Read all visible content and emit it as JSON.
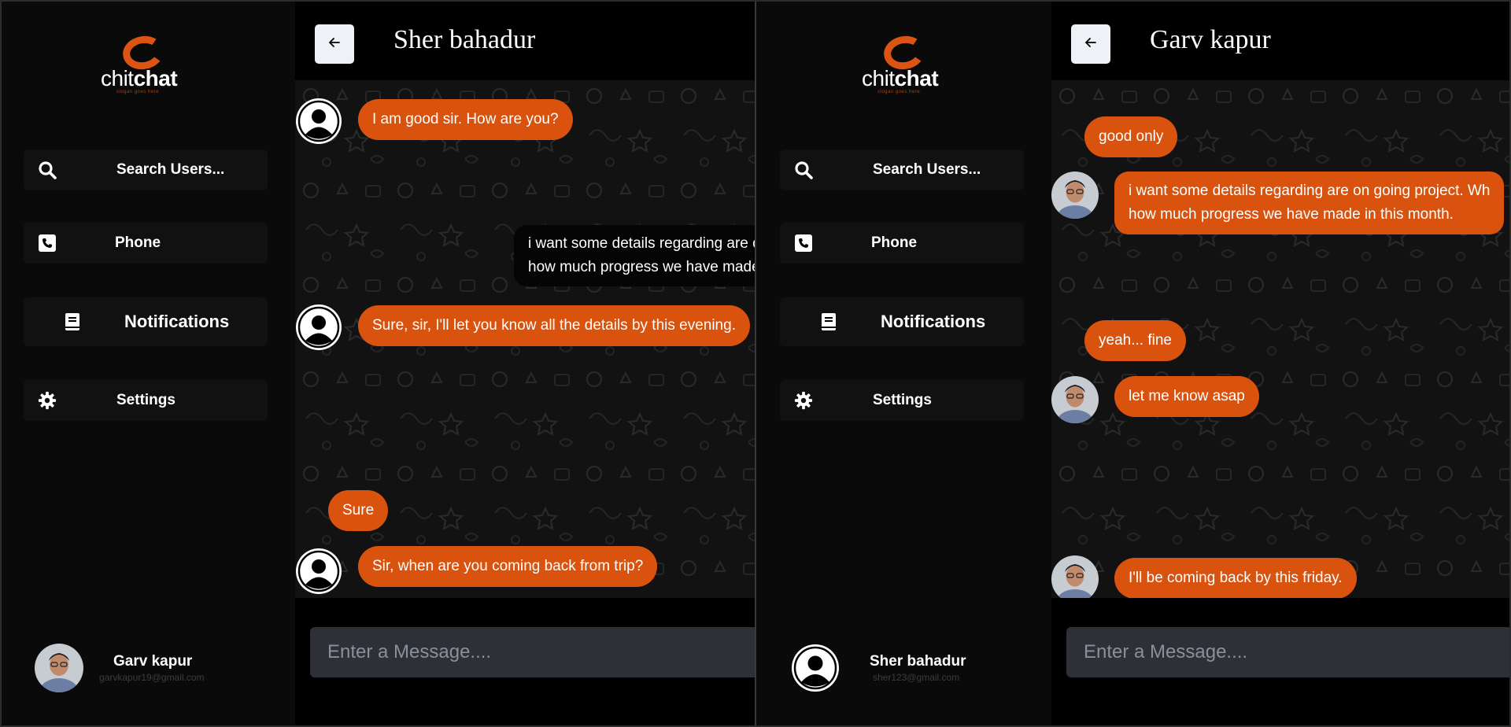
{
  "app": {
    "logo_text_light": "chit",
    "logo_text_bold": "chat",
    "logo_slogan": "slogan goes here",
    "accent_color": "#d9530f"
  },
  "nav": {
    "search_label": "Search Users...",
    "phone_label": "Phone",
    "notifications_label": "Notifications",
    "settings_label": "Settings"
  },
  "composer": {
    "placeholder": "Enter a Message...."
  },
  "panes": [
    {
      "chat_title": "Sher bahadur",
      "current_user": {
        "name": "Garv kapur",
        "email": "garvkapur19@gmail.com"
      },
      "messages": [
        {
          "text": "I am good sir. How are you?"
        },
        {
          "line1": "i want some details regarding are on going project. Wh",
          "line2": "how much progress we have made in this month."
        },
        {
          "text": "Sure, sir, I'll let you know all the details by this evening."
        },
        {
          "text": "Sure"
        },
        {
          "text": "Sir, when are you coming back from trip?"
        }
      ]
    },
    {
      "chat_title": "Garv kapur",
      "current_user": {
        "name": "Sher bahadur",
        "email": "sher123@gmail.com"
      },
      "messages": [
        {
          "text": "good only"
        },
        {
          "line1": "i want some details regarding are on going project. Wh",
          "line2": "how much progress we have made in this month."
        },
        {
          "text": "yeah... fine"
        },
        {
          "text": "let me know asap"
        },
        {
          "text": "I'll be coming back by this friday."
        }
      ]
    }
  ]
}
